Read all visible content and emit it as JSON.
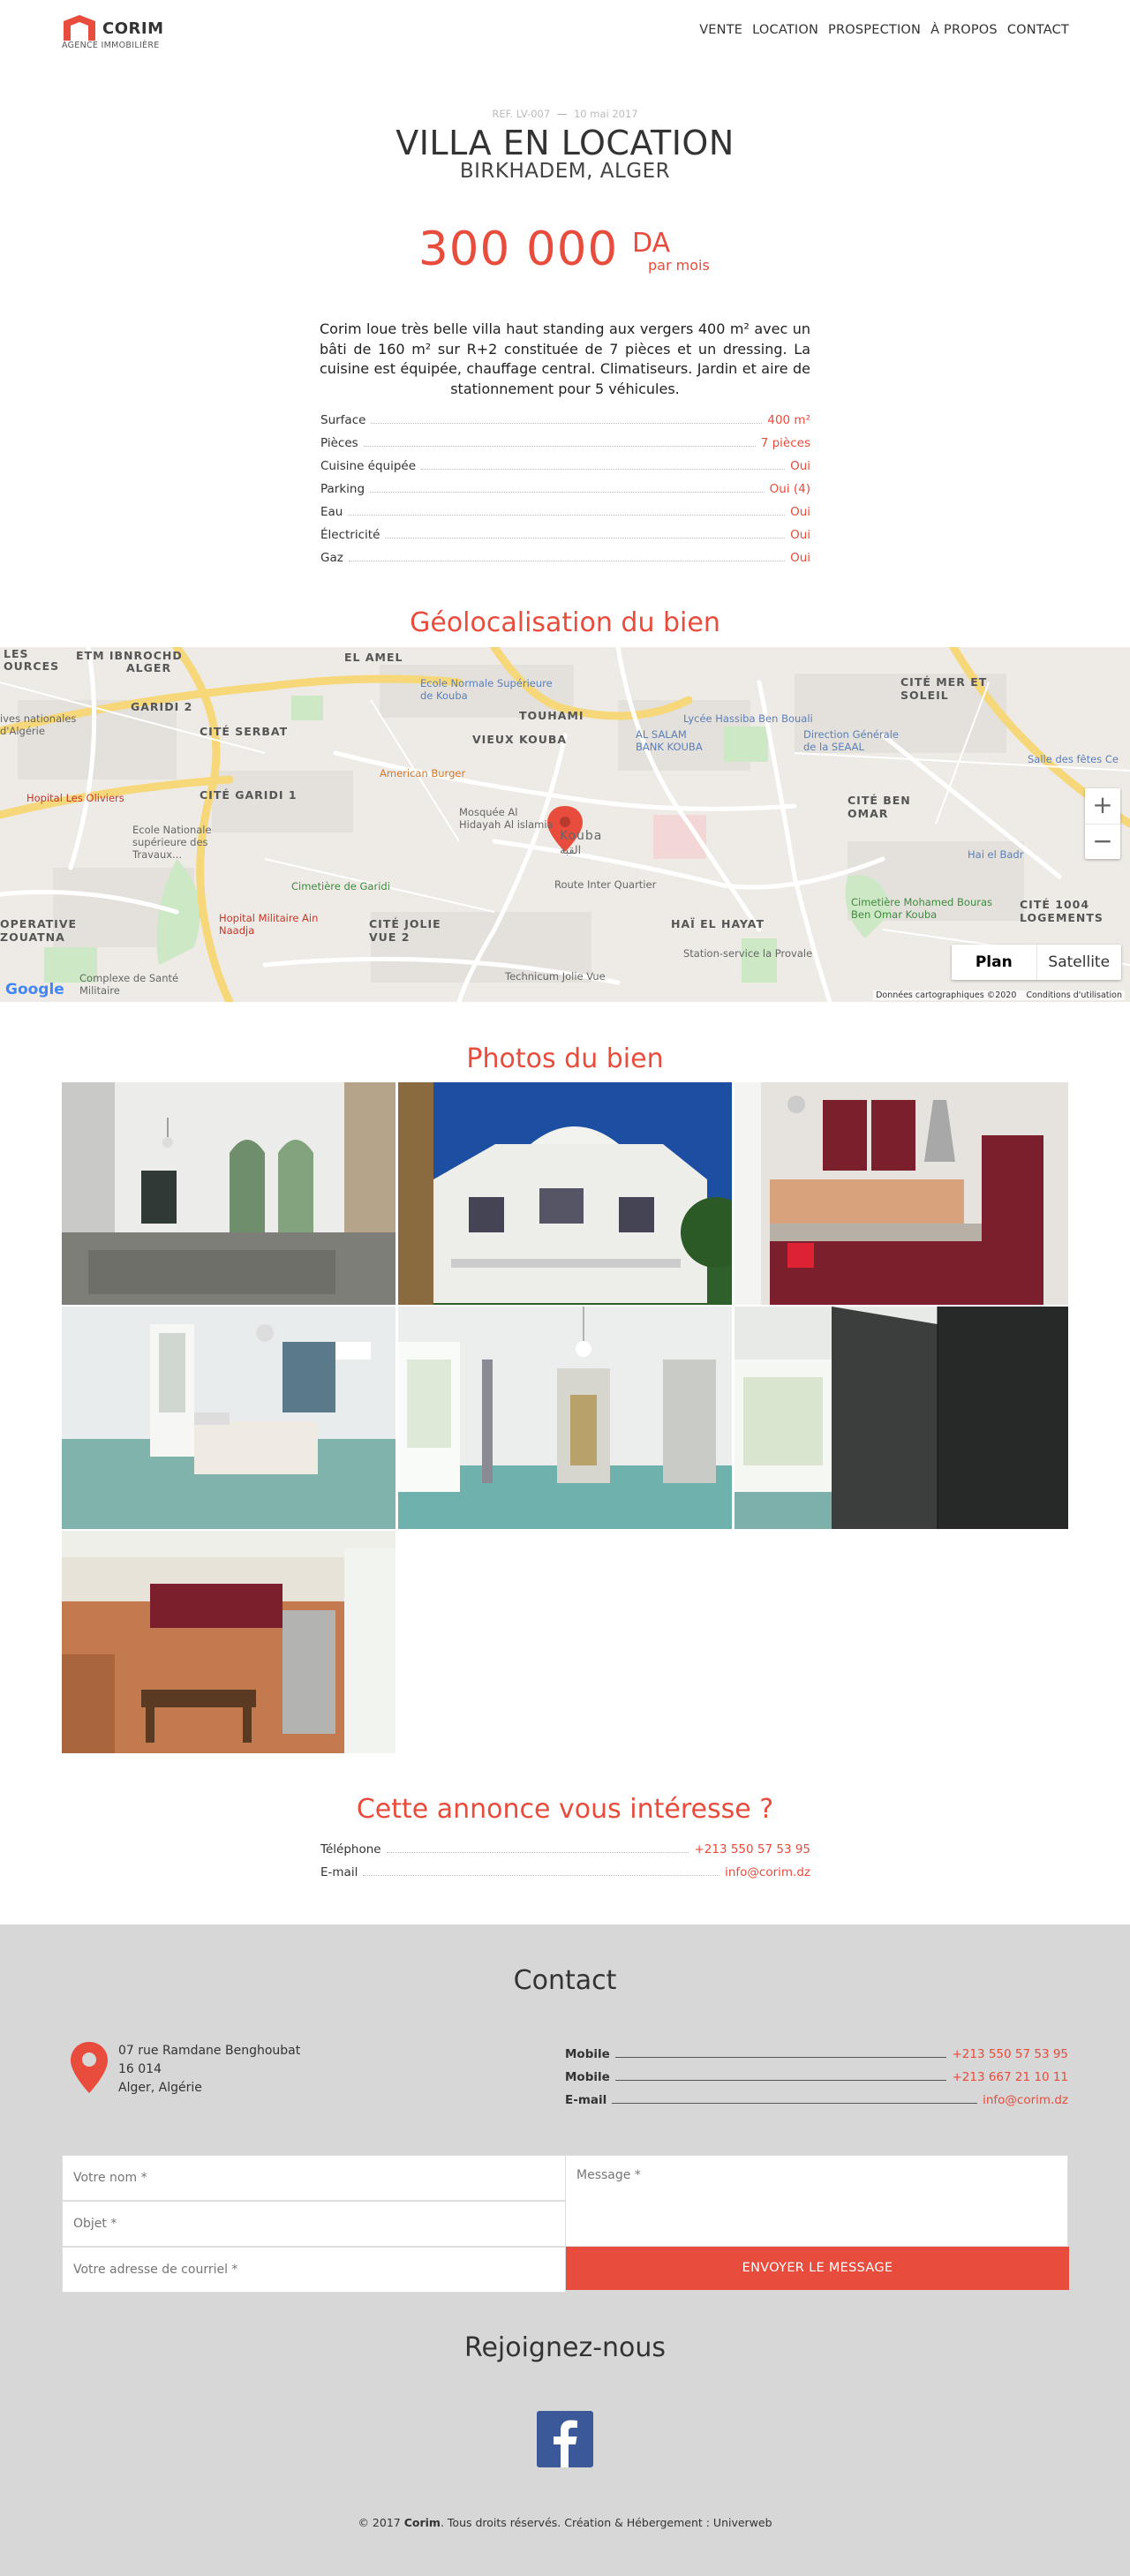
{
  "header": {
    "logo_name": "CORIM",
    "logo_sub": "AGENCE IMMOBILIÈRE",
    "nav": [
      "VENTE",
      "LOCATION",
      "PROSPECTION",
      "À PROPOS",
      "CONTACT"
    ]
  },
  "listing": {
    "ref": "REF. LV-007",
    "separator": "—",
    "date": "10 mai 2017",
    "title": "VILLA EN LOCATION",
    "location": "BIRKHADEM, ALGER",
    "price": "300 000",
    "currency": "DA",
    "period": "par mois",
    "description": "Corim loue très belle villa haut standing aux vergers 400 m² avec un bâti de 160 m² sur R+2 constituée de 7 pièces et un dressing. La cuisine est équipée, chauffage central. Climatiseurs. Jardin et aire de stationnement pour 5 véhicules.",
    "specs": [
      {
        "label": "Surface",
        "value": "400 m²"
      },
      {
        "label": "Pièces",
        "value": "7 pièces"
      },
      {
        "label": "Cuisine équipée",
        "value": "Oui"
      },
      {
        "label": "Parking",
        "value": "Oui (4)"
      },
      {
        "label": "Eau",
        "value": "Oui"
      },
      {
        "label": "Électricité",
        "value": "Oui"
      },
      {
        "label": "Gaz",
        "value": "Oui"
      }
    ]
  },
  "geo": {
    "title": "Géolocalisation du bien",
    "map_type_plan": "Plan",
    "map_type_satellite": "Satellite",
    "zoom_in": "+",
    "zoom_out": "−",
    "attribution": "Données cartographiques ©2020",
    "terms": "Conditions d'utilisation",
    "google": "Google",
    "labels": [
      "ETM IBNROCHD",
      "ALGER",
      "LES",
      "OURCES",
      "EL AMEL",
      "GARIDI 2",
      "CITÉ SERBAT",
      "TOUHAMI",
      "VIEUX KOUBA",
      "CITÉ GARIDI 1",
      "CITÉ BEN OMAR",
      "CITÉ MER ET SOLEIL",
      "CITÉ JOLIE VUE 2",
      "HAÏ EL HAYAT",
      "OPERATIVE ZOUATNA",
      "CITÉ 1004 LOGEMENTS",
      "Kouba",
      "القبة"
    ],
    "pois": [
      "Ecole Normale Supérieure de Kouba",
      "Lycée Hassiba Ben Bouali",
      "AL SALAM BANK KOUBA",
      "Direction Générale de la SEAAL",
      "Salle des fêtes Ce",
      "American Burger",
      "Mosquée Al Hidayah Al islamia",
      "Hopital Les Oliviers",
      "Ecole Nationale supérieure des Travaux...",
      "Cimetière de Garidi",
      "Hopital Militaire Ain Naadja",
      "Hai el Badr",
      "Cimetière Mohamed Bouras Ben Omar Kouba",
      "Station-service la Provale",
      "Technicum Jolie Vue",
      "Complexe de Santé Militaire",
      "ives nationales d'Algérie",
      "Route Inter Quartier"
    ]
  },
  "photos_title": "Photos du bien",
  "photos": [
    "photo-entrance",
    "photo-facade",
    "photo-kitchen",
    "photo-bedroom",
    "photo-hallway",
    "photo-wardrobe",
    "photo-kitchen-2"
  ],
  "interest": {
    "title": "Cette annonce vous intéresse ?",
    "rows": [
      {
        "label": "Téléphone",
        "value": "+213 550 57 53 95"
      },
      {
        "label": "E-mail",
        "value": "info@corim.dz"
      }
    ]
  },
  "footer": {
    "contact_title": "Contact",
    "address": [
      "07 rue Ramdane Benghoubat",
      "16 014",
      "Alger, Algérie"
    ],
    "contacts": [
      {
        "label": "Mobile",
        "value": "+213 550 57 53 95"
      },
      {
        "label": "Mobile",
        "value": "+213 667 21 10 11"
      },
      {
        "label": "E-mail",
        "value": "info@corim.dz"
      }
    ],
    "form": {
      "name": "Votre nom *",
      "subject": "Objet *",
      "email": "Votre adresse de courriel *",
      "message": "Message *",
      "submit": "ENVOYER LE MESSAGE"
    },
    "join_title": "Rejoignez-nous",
    "copyright_pre": "© 2017 ",
    "copyright_brand": "Corim",
    "copyright_post": ". Tous droits réservés. Création & Hébergement : Univerweb"
  },
  "colors": {
    "accent": "#e74c3c",
    "footer_bg": "#d7d7d7",
    "facebook": "#3b5998"
  }
}
